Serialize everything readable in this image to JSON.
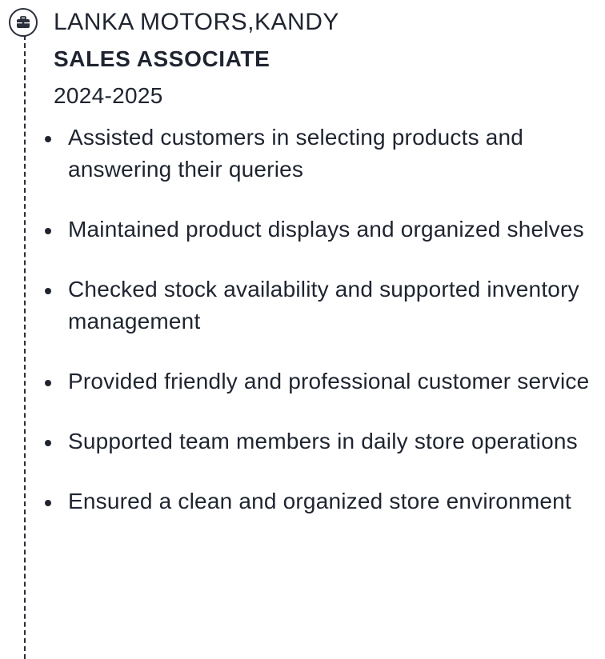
{
  "experience": {
    "company": "LANKA MOTORS,KANDY",
    "role": "SALES ASSOCIATE",
    "dates": "2024-2025",
    "marker_icon": "briefcase-icon",
    "duties": [
      "Assisted customers in selecting products and answering their queries",
      "Maintained product displays and organized shelves",
      "Checked stock availability and supported inventory management",
      "Provided friendly and professional customer service",
      "Supported team members in daily store operations",
      "Ensured a clean and organized store environment"
    ]
  },
  "colors": {
    "text": "#1f2430",
    "line": "#2a2f3a",
    "background": "#ffffff"
  }
}
